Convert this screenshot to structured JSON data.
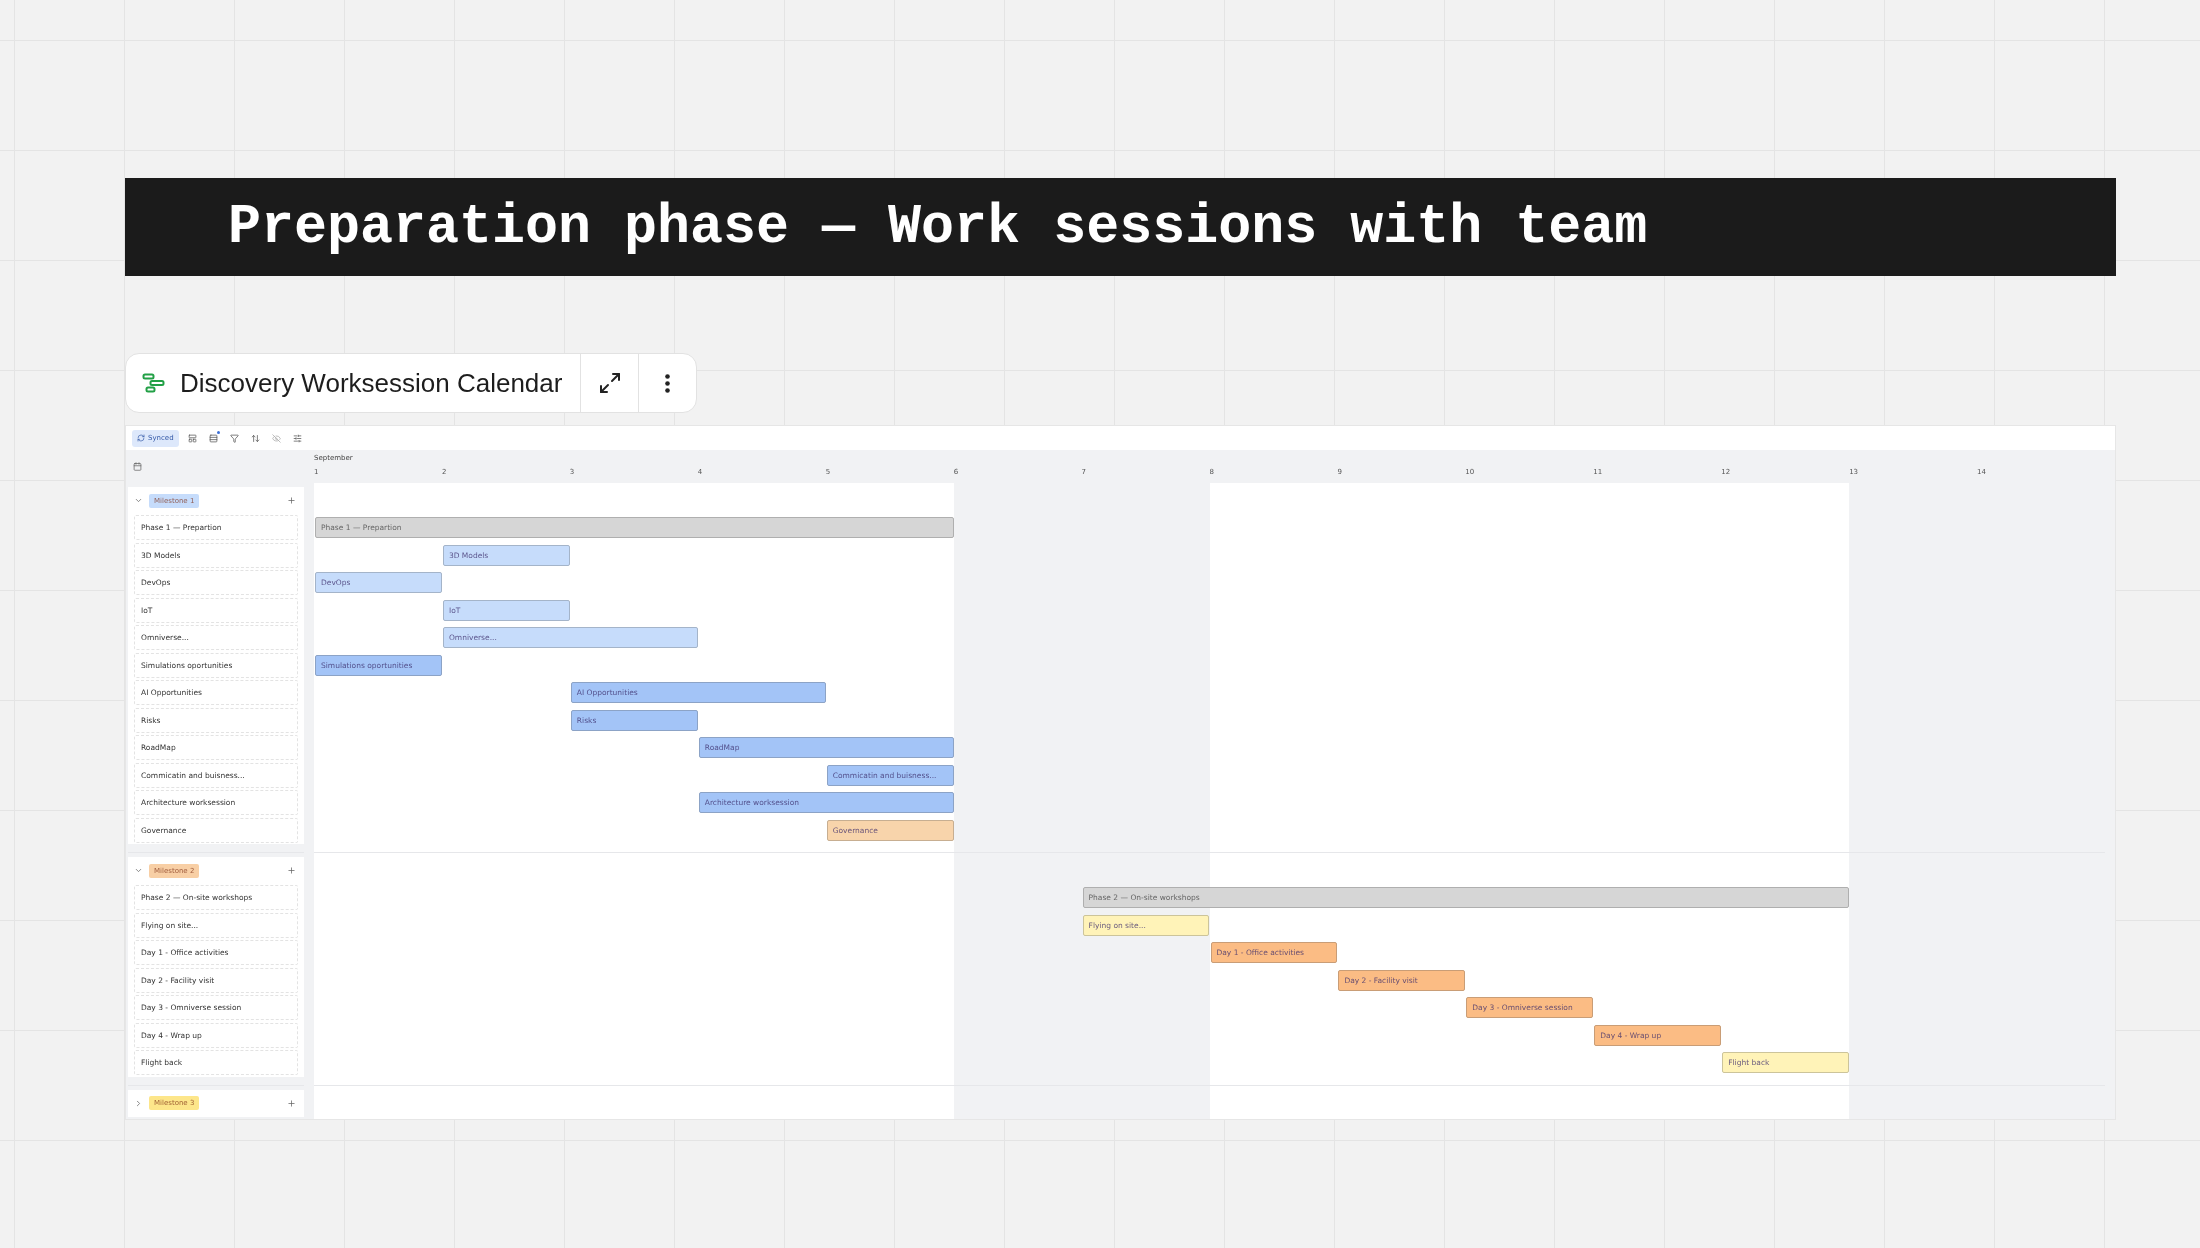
{
  "banner": {
    "title": "Preparation phase — Work sessions with team"
  },
  "card": {
    "title": "Discovery Worksession Calendar"
  },
  "toolbar": {
    "sync_label": "Synced",
    "group_badge": true
  },
  "timeline": {
    "month": "September",
    "days": [
      {
        "label": "1",
        "weekend": false
      },
      {
        "label": "2",
        "weekend": false
      },
      {
        "label": "3",
        "weekend": false
      },
      {
        "label": "4",
        "weekend": false
      },
      {
        "label": "5",
        "weekend": false
      },
      {
        "label": "6",
        "weekend": true
      },
      {
        "label": "7",
        "weekend": true
      },
      {
        "label": "8",
        "weekend": false
      },
      {
        "label": "9",
        "weekend": false
      },
      {
        "label": "10",
        "weekend": false
      },
      {
        "label": "11",
        "weekend": false
      },
      {
        "label": "12",
        "weekend": false
      },
      {
        "label": "13",
        "weekend": true
      },
      {
        "label": "14",
        "weekend": true
      }
    ]
  },
  "milestones": [
    {
      "label": "Milestone 1",
      "color": "#c6dcfb",
      "expanded": true,
      "rows": [
        {
          "name": "Phase 1 — Prepartion",
          "bar": {
            "label": "Phase 1 — Prepartion",
            "kind": "phase",
            "color": "#d6d6d6"
          }
        },
        {
          "name": "3D Models",
          "bar": {
            "label": "3D Models",
            "kind": "task",
            "color": "#c6dcfb"
          }
        },
        {
          "name": "DevOps",
          "bar": {
            "label": "DevOps",
            "kind": "task",
            "color": "#c6dcfb"
          }
        },
        {
          "name": "IoT",
          "bar": {
            "label": "IoT",
            "kind": "task",
            "color": "#c6dcfb"
          }
        },
        {
          "name": "Omniverse...",
          "bar": {
            "label": "Omniverse...",
            "kind": "task",
            "color": "#c6dcfb"
          }
        },
        {
          "name": "Simulations oportunities",
          "bar": {
            "label": "Simulations oportunities",
            "kind": "task",
            "color": "#a3c4f7"
          }
        },
        {
          "name": "AI Opportunities",
          "bar": {
            "label": "AI Opportunities",
            "kind": "task",
            "color": "#a3c4f7"
          }
        },
        {
          "name": "Risks",
          "bar": {
            "label": "Risks",
            "kind": "task",
            "color": "#a3c4f7"
          }
        },
        {
          "name": "RoadMap",
          "bar": {
            "label": "RoadMap",
            "kind": "task",
            "color": "#a3c4f7"
          }
        },
        {
          "name": "Commicatin and buisness...",
          "bar": {
            "label": "Commicatin and buisness...",
            "kind": "task",
            "color": "#a3c4f7"
          }
        },
        {
          "name": "Architecture worksession",
          "bar": {
            "label": "Architecture worksession",
            "kind": "task",
            "color": "#a3c4f7"
          }
        },
        {
          "name": "Governance",
          "bar": {
            "label": "Governance",
            "kind": "task",
            "color": "#f8d4ab"
          }
        }
      ]
    },
    {
      "label": "Milestone 2",
      "color": "#f8cfa5",
      "expanded": true,
      "rows": [
        {
          "name": "Phase 2 — On-site workshops",
          "bar": {
            "label": "Phase 2 — On-site workshops",
            "kind": "phase",
            "color": "#d6d6d6"
          }
        },
        {
          "name": "Flying on site...",
          "bar": {
            "label": "Flying on site...",
            "kind": "task",
            "color": "#fff3b8"
          }
        },
        {
          "name": "Day 1 - Office activities",
          "bar": {
            "label": "Day 1 - Office activities",
            "kind": "task",
            "color": "#fbbc84"
          }
        },
        {
          "name": "Day 2 - Facility visit",
          "bar": {
            "label": "Day 2 - Facility visit",
            "kind": "task",
            "color": "#fbbc84"
          }
        },
        {
          "name": "Day 3 - Omniverse session",
          "bar": {
            "label": "Day 3 - Omniverse session",
            "kind": "task",
            "color": "#fbbc84"
          }
        },
        {
          "name": "Day 4 - Wrap up",
          "bar": {
            "label": "Day 4 - Wrap up",
            "kind": "task",
            "color": "#fbbc84"
          }
        },
        {
          "name": "Flight back",
          "bar": {
            "label": "Flight back",
            "kind": "task",
            "color": "#fff3b8"
          }
        }
      ]
    },
    {
      "label": "Milestone 3",
      "color": "#fde68a",
      "expanded": false
    }
  ]
}
